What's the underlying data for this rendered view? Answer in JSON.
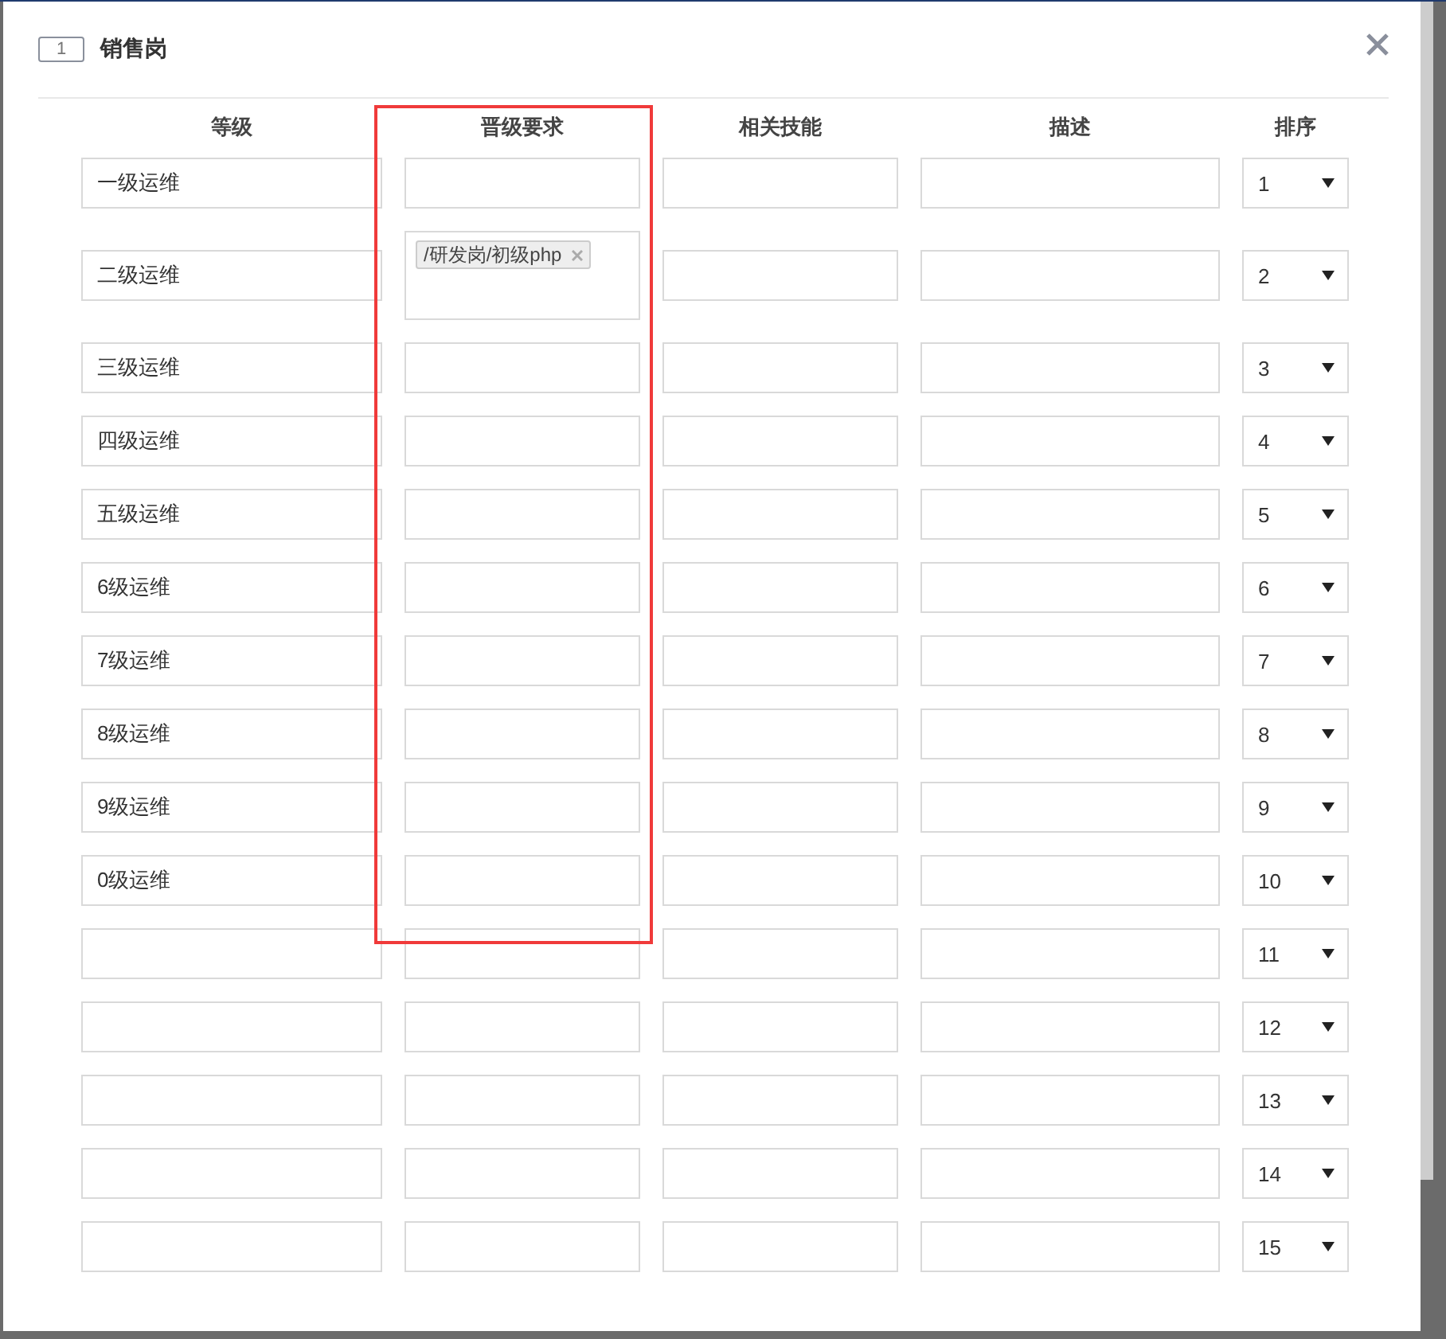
{
  "dialog": {
    "number": "1",
    "title": "销售岗"
  },
  "columns": [
    "等级",
    "晋级要求",
    "相关技能",
    "描述",
    "排序"
  ],
  "rows": [
    {
      "level": "一级运维",
      "sort": "1"
    },
    {
      "level": "二级运维",
      "requirements": [
        "/研发岗/初级php"
      ],
      "sort": "2"
    },
    {
      "level": "三级运维",
      "sort": "3"
    },
    {
      "level": "四级运维",
      "sort": "4"
    },
    {
      "level": "五级运维",
      "sort": "5"
    },
    {
      "level": "6级运维",
      "sort": "6"
    },
    {
      "level": "7级运维",
      "sort": "7"
    },
    {
      "level": "8级运维",
      "sort": "8"
    },
    {
      "level": "9级运维",
      "sort": "9"
    },
    {
      "level": "0级运维",
      "sort": "10"
    },
    {
      "sort": "11"
    },
    {
      "sort": "12"
    },
    {
      "sort": "13"
    },
    {
      "sort": "14"
    },
    {
      "sort": "15"
    }
  ]
}
